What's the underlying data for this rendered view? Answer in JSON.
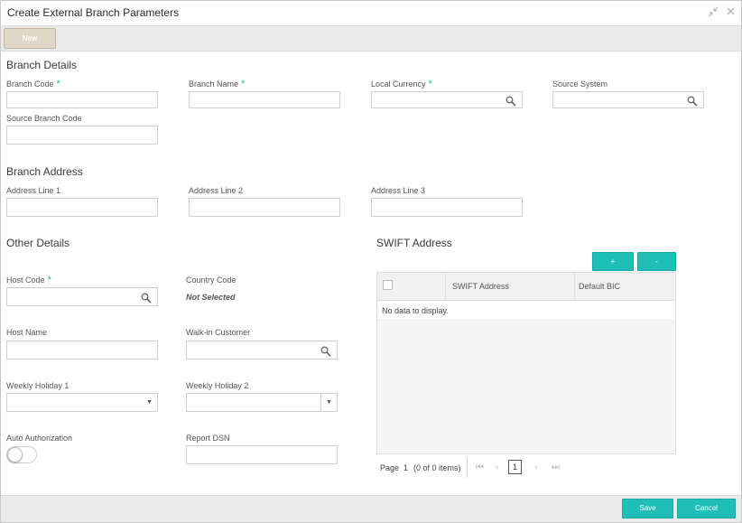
{
  "window": {
    "title": "Create External Branch Parameters"
  },
  "toolbar": {
    "new_label": "New"
  },
  "branch_details": {
    "heading": "Branch Details",
    "branch_code": {
      "label": "Branch Code",
      "required": "*",
      "value": ""
    },
    "branch_name": {
      "label": "Branch Name",
      "required": "*",
      "value": ""
    },
    "local_currency": {
      "label": "Local Currency",
      "required": "*",
      "value": ""
    },
    "source_system": {
      "label": "Source System",
      "value": ""
    },
    "source_branch_code": {
      "label": "Source Branch Code",
      "value": ""
    }
  },
  "branch_address": {
    "heading": "Branch Address",
    "line1": {
      "label": "Address Line 1",
      "value": ""
    },
    "line2": {
      "label": "Address Line 2",
      "value": ""
    },
    "line3": {
      "label": "Address Line 3",
      "value": ""
    }
  },
  "other_details": {
    "heading": "Other Details",
    "host_code": {
      "label": "Host Code",
      "required": "*",
      "value": ""
    },
    "country_code": {
      "label": "Country Code",
      "value": "Not Selected"
    },
    "host_name": {
      "label": "Host Name",
      "value": ""
    },
    "walkin_customer": {
      "label": "Walk-in Customer",
      "value": ""
    },
    "weekly_holiday_1": {
      "label": "Weekly Holiday 1",
      "value": ""
    },
    "weekly_holiday_2": {
      "label": "Weekly Holiday 2",
      "value": ""
    },
    "auto_authorization": {
      "label": "Auto Authorization",
      "enabled": false
    },
    "report_dsn": {
      "label": "Report DSN",
      "value": ""
    }
  },
  "swift": {
    "heading": "SWIFT Address",
    "add_label": "+",
    "remove_label": "-",
    "columns": [
      "SWIFT Address",
      "Default BIC"
    ],
    "empty_text": "No data to display.",
    "pager": {
      "page_label": "Page",
      "page_value": "1",
      "items_text": "(0 of 0 items)",
      "current": "1"
    }
  },
  "footer": {
    "save_label": "Save",
    "cancel_label": "Cancel"
  },
  "colors": {
    "accent": "#1fbfb8",
    "required": "#1ab3b3",
    "new_button": "#e0d7c7"
  },
  "icons": [
    "minimize-icon",
    "close-icon",
    "search-icon",
    "chevron-down-icon",
    "first-page-icon",
    "prev-page-icon",
    "next-page-icon",
    "last-page-icon"
  ]
}
